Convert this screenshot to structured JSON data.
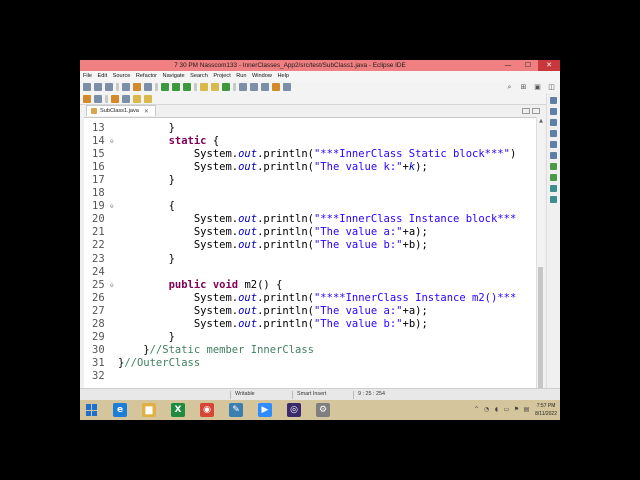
{
  "window": {
    "title": "7 30 PM  Nasscom133 - InnerClasses_App2/src/test/SubClass1.java - Eclipse IDE",
    "minimize": "—",
    "maximize": "☐",
    "close": "✕"
  },
  "menu": [
    "File",
    "Edit",
    "Source",
    "Refactor",
    "Navigate",
    "Search",
    "Project",
    "Run",
    "Window",
    "Help"
  ],
  "editor_tab": {
    "label": "SubClass1.java",
    "close": "✕"
  },
  "code_lines": [
    {
      "n": "13",
      "fold": "",
      "segs": [
        {
          "t": "        }",
          "c": ""
        }
      ]
    },
    {
      "n": "14",
      "fold": "⊖",
      "segs": [
        {
          "t": "        ",
          "c": ""
        },
        {
          "t": "static",
          "c": "kw"
        },
        {
          "t": " {",
          "c": ""
        }
      ]
    },
    {
      "n": "15",
      "fold": "",
      "segs": [
        {
          "t": "            System.",
          "c": ""
        },
        {
          "t": "out",
          "c": "fld"
        },
        {
          "t": ".println(",
          "c": ""
        },
        {
          "t": "\"***InnerClass Static block***\"",
          "c": "str"
        },
        {
          "t": ")",
          "c": ""
        }
      ]
    },
    {
      "n": "16",
      "fold": "",
      "segs": [
        {
          "t": "            System.",
          "c": ""
        },
        {
          "t": "out",
          "c": "fld"
        },
        {
          "t": ".println(",
          "c": ""
        },
        {
          "t": "\"The value k:\"",
          "c": "str"
        },
        {
          "t": "+",
          "c": ""
        },
        {
          "t": "k",
          "c": "fld"
        },
        {
          "t": ");",
          "c": ""
        }
      ]
    },
    {
      "n": "17",
      "fold": "",
      "segs": [
        {
          "t": "        }",
          "c": ""
        }
      ]
    },
    {
      "n": "18",
      "fold": "",
      "segs": [
        {
          "t": "",
          "c": ""
        }
      ]
    },
    {
      "n": "19",
      "fold": "⊖",
      "segs": [
        {
          "t": "        {",
          "c": ""
        }
      ]
    },
    {
      "n": "20",
      "fold": "",
      "segs": [
        {
          "t": "            System.",
          "c": ""
        },
        {
          "t": "out",
          "c": "fld"
        },
        {
          "t": ".println(",
          "c": ""
        },
        {
          "t": "\"***InnerClass Instance block***",
          "c": "str"
        }
      ]
    },
    {
      "n": "21",
      "fold": "",
      "segs": [
        {
          "t": "            System.",
          "c": ""
        },
        {
          "t": "out",
          "c": "fld"
        },
        {
          "t": ".println(",
          "c": ""
        },
        {
          "t": "\"The value a:\"",
          "c": "str"
        },
        {
          "t": "+a);",
          "c": ""
        }
      ]
    },
    {
      "n": "22",
      "fold": "",
      "segs": [
        {
          "t": "            System.",
          "c": ""
        },
        {
          "t": "out",
          "c": "fld"
        },
        {
          "t": ".println(",
          "c": ""
        },
        {
          "t": "\"The value b:\"",
          "c": "str"
        },
        {
          "t": "+b);",
          "c": ""
        }
      ]
    },
    {
      "n": "23",
      "fold": "",
      "segs": [
        {
          "t": "        }",
          "c": ""
        }
      ]
    },
    {
      "n": "24",
      "fold": "",
      "segs": [
        {
          "t": "",
          "c": ""
        }
      ]
    },
    {
      "n": "25",
      "fold": "⊖",
      "segs": [
        {
          "t": "        ",
          "c": ""
        },
        {
          "t": "public",
          "c": "kw"
        },
        {
          "t": " ",
          "c": ""
        },
        {
          "t": "void",
          "c": "kw"
        },
        {
          "t": " m2() {",
          "c": ""
        }
      ]
    },
    {
      "n": "26",
      "fold": "",
      "segs": [
        {
          "t": "            System.",
          "c": ""
        },
        {
          "t": "out",
          "c": "fld"
        },
        {
          "t": ".println(",
          "c": ""
        },
        {
          "t": "\"****InnerClass Instance m2()***",
          "c": "str"
        }
      ]
    },
    {
      "n": "27",
      "fold": "",
      "segs": [
        {
          "t": "            System.",
          "c": ""
        },
        {
          "t": "out",
          "c": "fld"
        },
        {
          "t": ".println(",
          "c": ""
        },
        {
          "t": "\"The value a:\"",
          "c": "str"
        },
        {
          "t": "+a);",
          "c": ""
        }
      ]
    },
    {
      "n": "28",
      "fold": "",
      "segs": [
        {
          "t": "            System.",
          "c": ""
        },
        {
          "t": "out",
          "c": "fld"
        },
        {
          "t": ".println(",
          "c": ""
        },
        {
          "t": "\"The value b:\"",
          "c": "str"
        },
        {
          "t": "+b);",
          "c": ""
        }
      ]
    },
    {
      "n": "29",
      "fold": "",
      "segs": [
        {
          "t": "        }",
          "c": ""
        }
      ]
    },
    {
      "n": "30",
      "fold": "",
      "segs": [
        {
          "t": "    }",
          "c": ""
        },
        {
          "t": "//Static member InnerClass",
          "c": "cmt"
        }
      ]
    },
    {
      "n": "31",
      "fold": "",
      "segs": [
        {
          "t": "}",
          "c": ""
        },
        {
          "t": "//OuterClass",
          "c": "cmt"
        }
      ]
    },
    {
      "n": "32",
      "fold": "",
      "segs": [
        {
          "t": "",
          "c": ""
        }
      ]
    }
  ],
  "status": {
    "writable": "Writable",
    "insert_mode": "Smart Insert",
    "position": "9 : 25 : 254"
  },
  "taskbar": {
    "apps": [
      {
        "name": "internet-explorer",
        "glyph": "e",
        "color": "#1c7ed6"
      },
      {
        "name": "file-explorer",
        "glyph": "▆",
        "color": "#e0b040"
      },
      {
        "name": "excel",
        "glyph": "X",
        "color": "#1f8b3f"
      },
      {
        "name": "chrome",
        "glyph": "◉",
        "color": "#d64536"
      },
      {
        "name": "tool",
        "glyph": "✎",
        "color": "#3a7fb0"
      },
      {
        "name": "zoom",
        "glyph": "▶",
        "color": "#2d8cff"
      },
      {
        "name": "eclipse",
        "glyph": "◎",
        "color": "#3b2a6b"
      },
      {
        "name": "utility",
        "glyph": "⚙",
        "color": "#7f7f7f"
      }
    ],
    "time": "7:57 PM",
    "date": "8/11/2022"
  }
}
